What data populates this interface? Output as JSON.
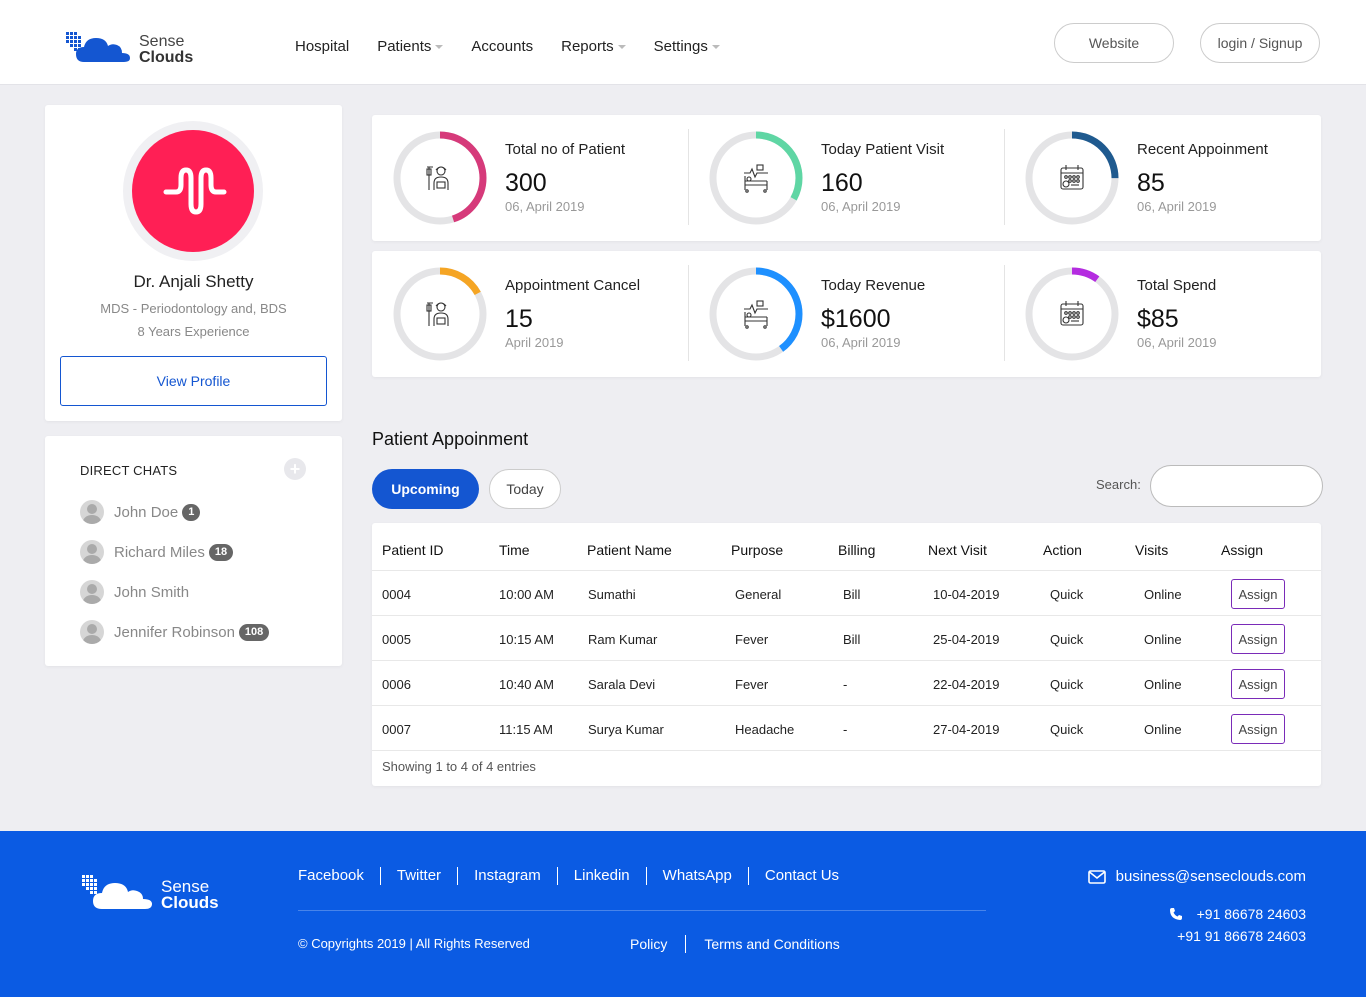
{
  "brand": {
    "line1": "Sense",
    "line2": "Clouds",
    "accent": "#1456d1",
    "footer_bg": "#0b5be3"
  },
  "nav": [
    {
      "label": "Hospital",
      "dropdown": false
    },
    {
      "label": "Patients",
      "dropdown": true
    },
    {
      "label": "Accounts",
      "dropdown": false
    },
    {
      "label": "Reports",
      "dropdown": true
    },
    {
      "label": "Settings",
      "dropdown": true
    }
  ],
  "header": {
    "website_label": "Website",
    "login_label": "login / Signup"
  },
  "profile": {
    "name": "Dr. Anjali Shetty",
    "specialty": "MDS - Periodontology and, BDS",
    "experience": "8 Years Experience",
    "view_profile_label": "View Profile",
    "avatar_color": "#ff1f55"
  },
  "chats": {
    "title": "DIRECT CHATS",
    "add_label": "+",
    "items": [
      {
        "name": "John Doe",
        "badge": "1"
      },
      {
        "name": "Richard Miles",
        "badge": "18"
      },
      {
        "name": "John Smith",
        "badge": ""
      },
      {
        "name": "Jennifer Robinson",
        "badge": "108"
      }
    ]
  },
  "stats": [
    {
      "label": "Total no of Patient",
      "value": "300",
      "date": "06, April 2019",
      "icon": "patient-icon",
      "color": "#d63a7a",
      "progress": 0.45
    },
    {
      "label": "Today Patient Visit",
      "value": "160",
      "date": "06, April 2019",
      "icon": "hospital-bed-icon",
      "color": "#5fd6a4",
      "progress": 0.33
    },
    {
      "label": "Recent Appoinment",
      "value": "85",
      "date": "06, April 2019",
      "icon": "calendar-icon",
      "color": "#1f5a8f",
      "progress": 0.25
    },
    {
      "label": "Appointment Cancel",
      "value": "15",
      "date": "April 2019",
      "icon": "patient-icon",
      "color": "#f5a524",
      "progress": 0.17
    },
    {
      "label": "Today Revenue",
      "value": "$1600",
      "date": "06, April 2019",
      "icon": "hospital-bed-icon",
      "color": "#1e90ff",
      "progress": 0.4
    },
    {
      "label": "Total Spend",
      "value": "$85",
      "date": "06, April 2019",
      "icon": "calendar-icon",
      "color": "#b42ce0",
      "progress": 0.1
    }
  ],
  "appointments": {
    "title": "Patient Appoinment",
    "tabs": [
      {
        "label": "Upcoming",
        "active": true
      },
      {
        "label": "Today",
        "active": false
      }
    ],
    "search_label": "Search:",
    "search_value": "",
    "columns": [
      "Patient ID",
      "Time",
      "Patient Name",
      "Purpose",
      "Billing",
      "Next Visit",
      "Action",
      "Visits",
      "Assign"
    ],
    "rows": [
      {
        "id": "0004",
        "time": "10:00 AM",
        "name": "Sumathi",
        "purpose": "General",
        "billing": "Bill",
        "next": "10-04-2019",
        "action": "Quick",
        "visits": "Online",
        "assign": "Assign"
      },
      {
        "id": "0005",
        "time": "10:15 AM",
        "name": "Ram Kumar",
        "purpose": "Fever",
        "billing": "Bill",
        "next": "25-04-2019",
        "action": "Quick",
        "visits": "Online",
        "assign": "Assign"
      },
      {
        "id": "0006",
        "time": "10:40 AM",
        "name": "Sarala Devi",
        "purpose": "Fever",
        "billing": "-",
        "next": "22-04-2019",
        "action": "Quick",
        "visits": "Online",
        "assign": "Assign"
      },
      {
        "id": "0007",
        "time": "11:15 AM",
        "name": "Surya Kumar",
        "purpose": "Headache",
        "billing": "-",
        "next": "27-04-2019",
        "action": "Quick",
        "visits": "Online",
        "assign": "Assign"
      }
    ],
    "footer": "Showing 1 to 4 of 4 entries"
  },
  "footer": {
    "links": [
      "Facebook",
      "Twitter",
      "Instagram",
      "Linkedin",
      "WhatsApp",
      "Contact Us"
    ],
    "copyright": "© Copyrights 2019 | All Rights Reserved",
    "legal": [
      "Policy",
      "Terms and Conditions"
    ],
    "email": "business@senseclouds.com",
    "phone1": "+91 86678 24603",
    "phone2": "+91 91 86678 24603"
  }
}
